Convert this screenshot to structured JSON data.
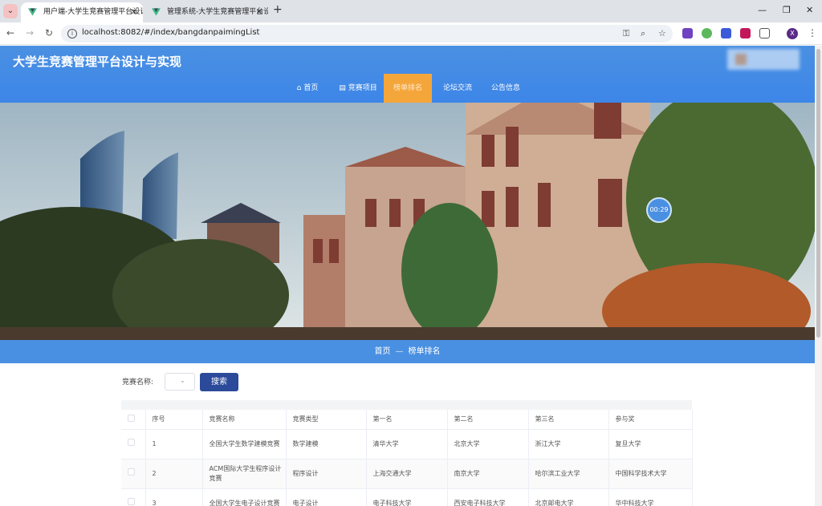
{
  "browser": {
    "tabs": [
      {
        "title": "用户端-大学生竞赛管理平台设计",
        "active": true
      },
      {
        "title": "管理系统-大学生竞赛管理平台设",
        "active": false
      }
    ],
    "url": "localhost:8082/#/index/bangdanpaimingList",
    "profile_initial": "X"
  },
  "site": {
    "title": "大学生竞赛管理平台设计与实现"
  },
  "nav": {
    "items": [
      {
        "label": "首页",
        "icon": "home-icon",
        "active": false
      },
      {
        "label": "竞赛项目",
        "icon": "list-icon",
        "active": false
      },
      {
        "label": "榜单排名",
        "icon": "",
        "active": true
      },
      {
        "label": "论坛交流",
        "icon": "",
        "active": false
      },
      {
        "label": "公告信息",
        "icon": "",
        "active": false
      }
    ]
  },
  "banner": {
    "timer": "00:29"
  },
  "breadcrumb": {
    "home": "首页",
    "separator": "—",
    "current": "榜单排名"
  },
  "search": {
    "label": "竞赛名称:",
    "button": "搜索"
  },
  "table": {
    "headers": [
      "序号",
      "竞赛名称",
      "竞赛类型",
      "第一名",
      "第二名",
      "第三名",
      "参与奖"
    ],
    "rows": [
      {
        "index": "1",
        "name": "全国大学生数学建模竞赛",
        "type": "数学建模",
        "first": "清华大学",
        "second": "北京大学",
        "third": "浙江大学",
        "participation": "复旦大学"
      },
      {
        "index": "2",
        "name": "ACM国际大学生程序设计竞赛",
        "type": "程序设计",
        "first": "上海交通大学",
        "second": "南京大学",
        "third": "哈尔滨工业大学",
        "participation": "中国科学技术大学"
      },
      {
        "index": "3",
        "name": "全国大学生电子设计竞赛",
        "type": "电子设计",
        "first": "电子科技大学",
        "second": "西安电子科技大学",
        "third": "北京邮电大学",
        "participation": "华中科技大学"
      }
    ]
  },
  "colors": {
    "primary": "#4a90e2",
    "nav_active": "#f5a63a",
    "search_button": "#2c4a9a"
  }
}
